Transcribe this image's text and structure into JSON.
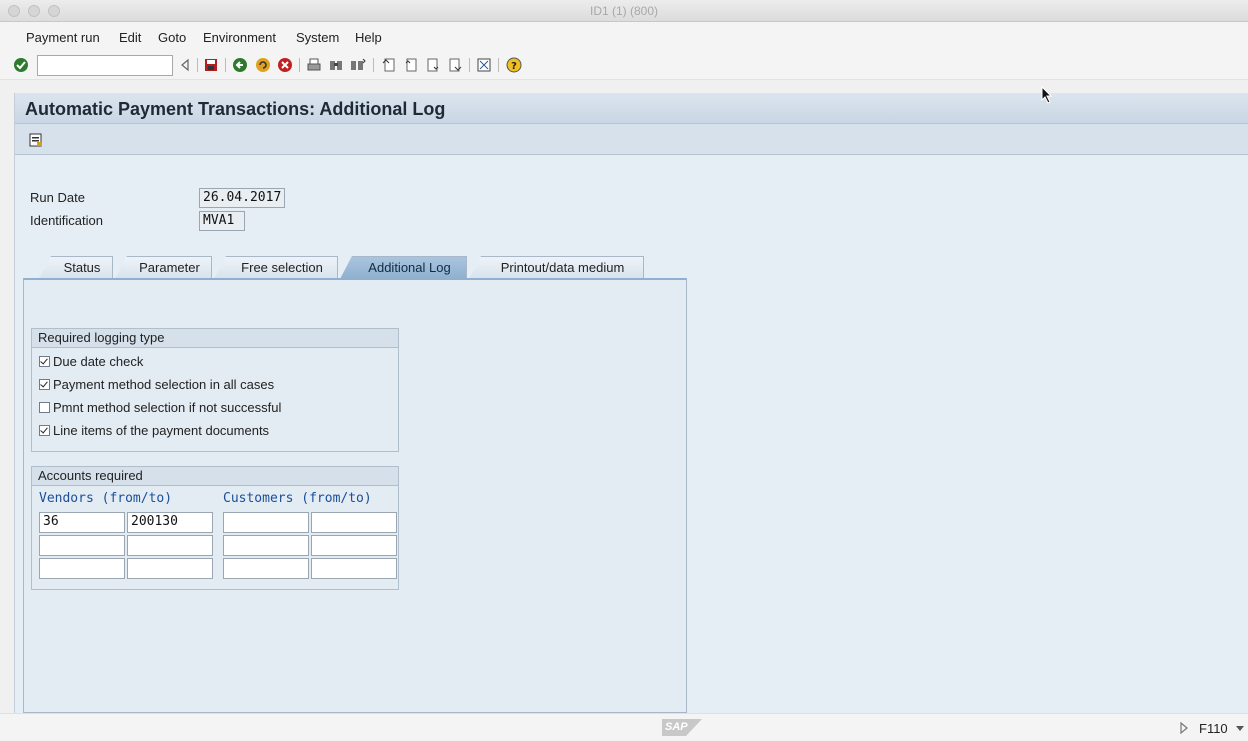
{
  "window": {
    "title": "ID1 (1) (800)"
  },
  "menu": [
    "Payment run",
    "Edit",
    "Goto",
    "Environment",
    "System",
    "Help"
  ],
  "toolbar": {
    "command_value": ""
  },
  "page": {
    "title": "Automatic Payment Transactions: Additional Log"
  },
  "header_fields": {
    "run_date_label": "Run Date",
    "run_date_value": "26.04.2017",
    "identification_label": "Identification",
    "identification_value": "MVA1"
  },
  "tabs": [
    "Status",
    "Parameter",
    "Free selection",
    "Additional Log",
    "Printout/data medium"
  ],
  "active_tab": "Additional Log",
  "logging_group": {
    "title": "Required logging type",
    "options": [
      {
        "label": "Due date check",
        "checked": true
      },
      {
        "label": "Payment method selection in all cases",
        "checked": true
      },
      {
        "label": "Pmnt method selection if not successful",
        "checked": false
      },
      {
        "label": "Line items of the payment documents",
        "checked": true
      }
    ]
  },
  "accounts_group": {
    "title": "Accounts required",
    "vendors_label": "Vendors (from/to)",
    "customers_label": "Customers (from/to)",
    "rows": [
      [
        "36",
        "200130",
        "",
        ""
      ],
      [
        "",
        "",
        "",
        ""
      ],
      [
        "",
        "",
        "",
        ""
      ]
    ]
  },
  "status": {
    "logo_text": "SAP",
    "transaction": "F110"
  }
}
